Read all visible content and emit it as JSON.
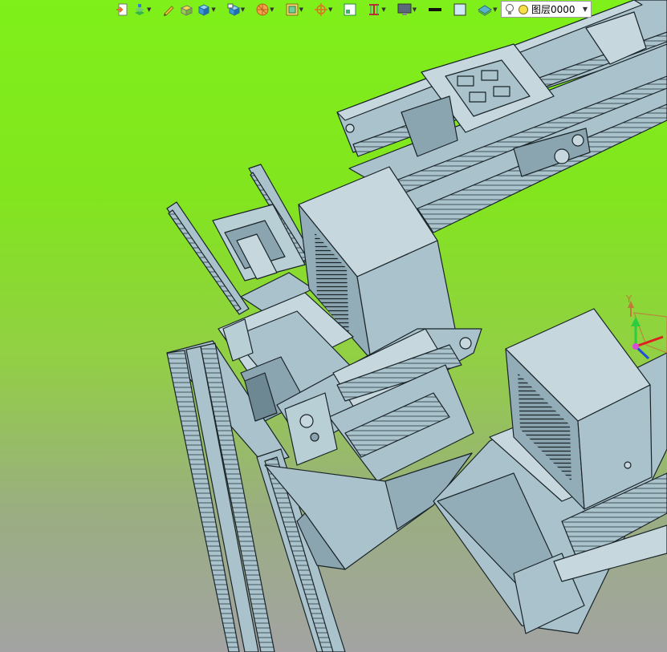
{
  "toolbar": {
    "buttons": [
      {
        "id": "view-tool-1",
        "icon": "document-arrow-icon",
        "has_dropdown": false
      },
      {
        "id": "view-tool-2",
        "icon": "layers-green-icon",
        "has_dropdown": true
      },
      {
        "id": "view-tool-3",
        "icon": "pencil-icon",
        "has_dropdown": false
      },
      {
        "id": "view-tool-4",
        "icon": "box-yellow-icon",
        "has_dropdown": false
      },
      {
        "id": "view-tool-5",
        "icon": "cube-blue-icon",
        "has_dropdown": true
      },
      {
        "id": "view-tool-6",
        "icon": "cube-display-icon",
        "has_dropdown": true
      },
      {
        "id": "view-tool-7",
        "icon": "orange-sphere-icon",
        "has_dropdown": true
      },
      {
        "id": "view-tool-8",
        "icon": "frame-icon",
        "has_dropdown": true
      },
      {
        "id": "view-tool-9",
        "icon": "target-icon",
        "has_dropdown": true
      },
      {
        "id": "view-tool-10",
        "icon": "window-icon",
        "has_dropdown": false
      },
      {
        "id": "view-tool-11",
        "icon": "bracket-icon",
        "has_dropdown": true
      },
      {
        "id": "view-tool-12",
        "icon": "monitor-icon",
        "has_dropdown": true
      },
      {
        "id": "view-tool-13",
        "icon": "line-black-icon",
        "has_dropdown": false
      },
      {
        "id": "view-tool-14",
        "icon": "color-square-icon",
        "has_dropdown": false
      },
      {
        "id": "view-tool-15",
        "icon": "plane-teal-icon",
        "has_dropdown": true
      }
    ]
  },
  "layer": {
    "current": "图层0000"
  },
  "triad": {
    "y_label": "Y"
  },
  "colors": {
    "background_top": "#7ff01a",
    "background_bottom": "#a3a3a3",
    "model_fill": "#a9c2cc",
    "model_dark": "#7f9aa5",
    "model_edge": "#1a2428"
  }
}
